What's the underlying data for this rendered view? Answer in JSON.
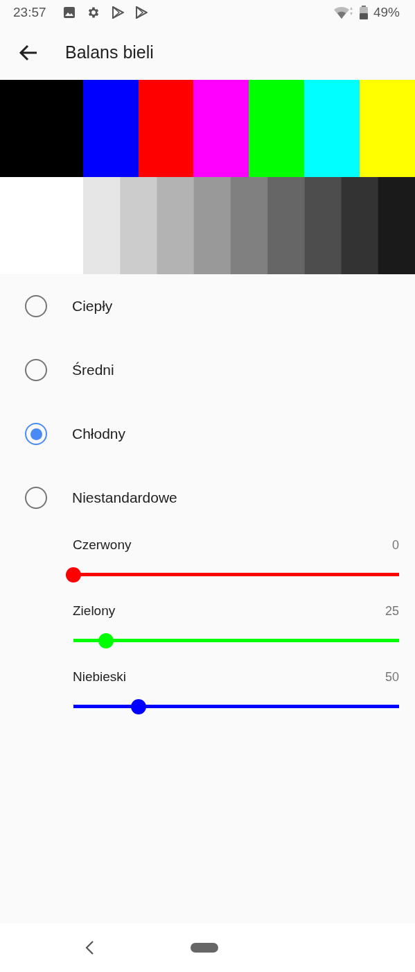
{
  "status_bar": {
    "time": "23:57",
    "battery": "49%"
  },
  "app_bar": {
    "title": "Balans bieli"
  },
  "options": [
    {
      "label": "Ciepły",
      "selected": false
    },
    {
      "label": "Średni",
      "selected": false
    },
    {
      "label": "Chłodny",
      "selected": true
    },
    {
      "label": "Niestandardowe",
      "selected": false
    }
  ],
  "sliders": [
    {
      "label": "Czerwony",
      "value": "0",
      "level": 0,
      "color": "#ff0000"
    },
    {
      "label": "Zielony",
      "value": "25",
      "level": 0.1,
      "color": "#00ff00"
    },
    {
      "label": "Niebieski",
      "value": "50",
      "level": 0.2,
      "color": "#0000ff"
    }
  ]
}
